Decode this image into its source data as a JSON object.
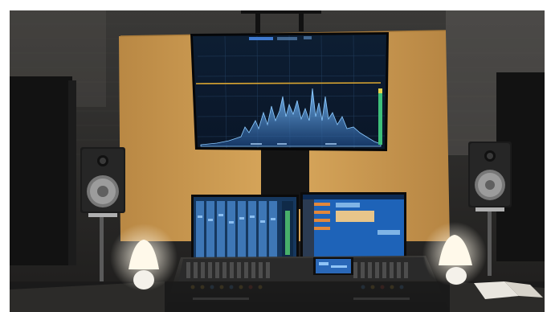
{
  "scene": {
    "kind": "photograph",
    "subject": "recording-studio-control-room",
    "colors": {
      "frame_white": "#ffffff",
      "brick_wall": "#2d2d2b",
      "wood_panel": "#cf9d52",
      "screen_blue": "#1a62b3",
      "spectrum_line": "#6fb8ff",
      "threshold_line": "#d9a531",
      "lamp_glow": "#fff6e0",
      "desk_dark": "#1d1d1d"
    }
  }
}
